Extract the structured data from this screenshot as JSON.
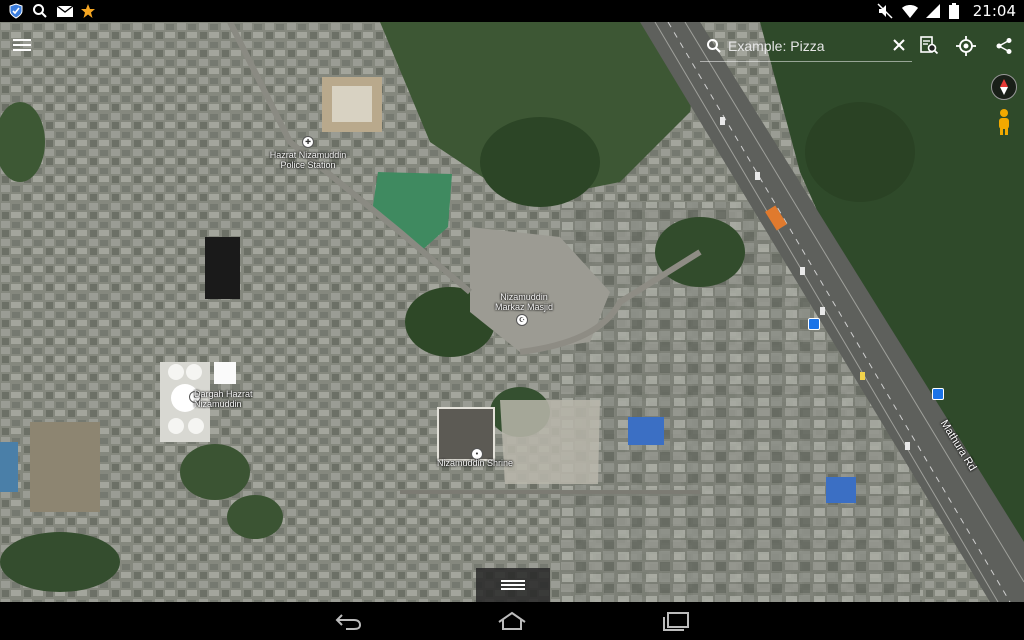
{
  "status_bar": {
    "time": "21:04",
    "left_icons": [
      "shield-icon",
      "search-icon",
      "mail-icon",
      "star-icon"
    ],
    "right_icons": [
      "mute-icon",
      "wifi-icon",
      "signal-icon",
      "battery-icon"
    ]
  },
  "search": {
    "placeholder": "Example: Pizza",
    "value": ""
  },
  "toolbar": {
    "icons": [
      "menu-icon",
      "search-icon",
      "clear-icon",
      "search-history-icon",
      "my-location-icon",
      "share-icon",
      "compass-icon",
      "pegman-icon"
    ]
  },
  "map": {
    "labels": {
      "police_station": "Hazrat Nizamuddin\nPolice Station",
      "masjid": "Nizamuddin\nMarkaz Masjid",
      "dargah": "Dargah Hazrat\nNizamuddin",
      "shrine": "Nizamuddin Shrine",
      "road": "Mathura Rd"
    }
  },
  "nav_bar": {
    "buttons": [
      "back-icon",
      "home-icon",
      "recents-icon"
    ]
  },
  "colors": {
    "status_bar": "#000000",
    "accent": "#1a73e8"
  }
}
